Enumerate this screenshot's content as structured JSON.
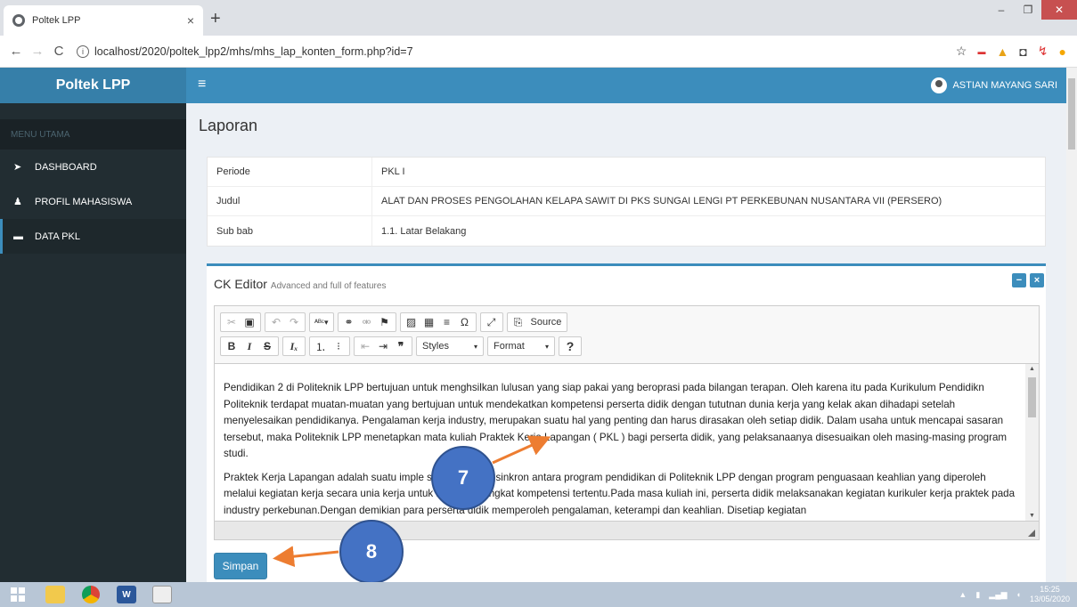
{
  "browser": {
    "tab_title": "Poltek LPP",
    "tab_close": "×",
    "new_tab": "+",
    "url": "localhost/2020/poltek_lpp2/mhs/mhs_lap_konten_form.php?id=7"
  },
  "header": {
    "logo": "Poltek LPP",
    "menu_toggle": "≡",
    "user_name": "ASTIAN MAYANG SARI"
  },
  "sidebar": {
    "section": "MENU UTAMA",
    "items": [
      {
        "label": "DASHBOARD",
        "icon": "paper-plane-icon"
      },
      {
        "label": "PROFIL MAHASISWA",
        "icon": "user-icon"
      },
      {
        "label": "DATA PKL",
        "icon": "book-icon",
        "active": true
      }
    ]
  },
  "main": {
    "title": "Laporan",
    "info": [
      {
        "key": "Periode",
        "value": "PKL I"
      },
      {
        "key": "Judul",
        "value": "ALAT DAN PROSES PENGOLAHAN KELAPA SAWIT DI PKS SUNGAI LENGI PT PERKEBUNAN NUSANTARA VII (PERSERO)"
      },
      {
        "key": "Sub bab",
        "value": "1.1. Latar Belakang"
      }
    ],
    "editor_box": {
      "title": "CK Editor",
      "subtitle": "Advanced and full of features",
      "toolbar": {
        "source": "Source",
        "styles": "Styles",
        "format": "Format",
        "help": "?"
      },
      "paragraphs": [
        "Pendidikan 2 di Politeknik LPP bertujuan untuk menghsilkan lulusan yang siap pakai yang beroprasi pada bilangan terapan. Oleh karena itu pada Kurikulum Pendidikn Politeknik terdapat muatan-muatan yang bertujuan untuk mendekatkan kompetensi perserta didik dengan tututnan dunia kerja yang kelak akan dihadapi setelah menyelesaikan pendidikanya. Pengalaman kerja industry, merupakan suatu hal yang penting dan harus dirasakan oleh setiap didik. Dalam usaha untuk mencapai sasaran tersebut, maka Politeknik LPP menetapkan mata kuliah Praktek Kerja Lapangan ( PKL ) bagi perserta didik, yang pelaksanaanya disesuaikan oleh masing-masing program studi.",
        "Praktek Kerja Lapangan adalah suatu imple sistematis dan sinkron antara program pendidikan di Politeknik LPP dengan program penguasaan keahlian yang diperoleh melalui kegiatan kerja secara unia kerja untuk mencapai tingkat kompetensi tertentu.Pada masa kuliah ini, perserta didik melaksanakan kegiatan kurikuler kerja praktek pada industry perkebunan.Dengan demikian para perserta didik memperoleh pengalaman, keterampi dan keahlian. Disetiap kegiatan"
      ]
    },
    "save_label": "Simpan"
  },
  "annotations": [
    {
      "label": "7"
    },
    {
      "label": "8"
    }
  ],
  "taskbar": {
    "time": "15:25",
    "date": "13/05/2020"
  },
  "colors": {
    "header": "#3c8dbc",
    "sidebar": "#222d32",
    "callout": "#4472c4",
    "arrow": "#ed7d31"
  }
}
